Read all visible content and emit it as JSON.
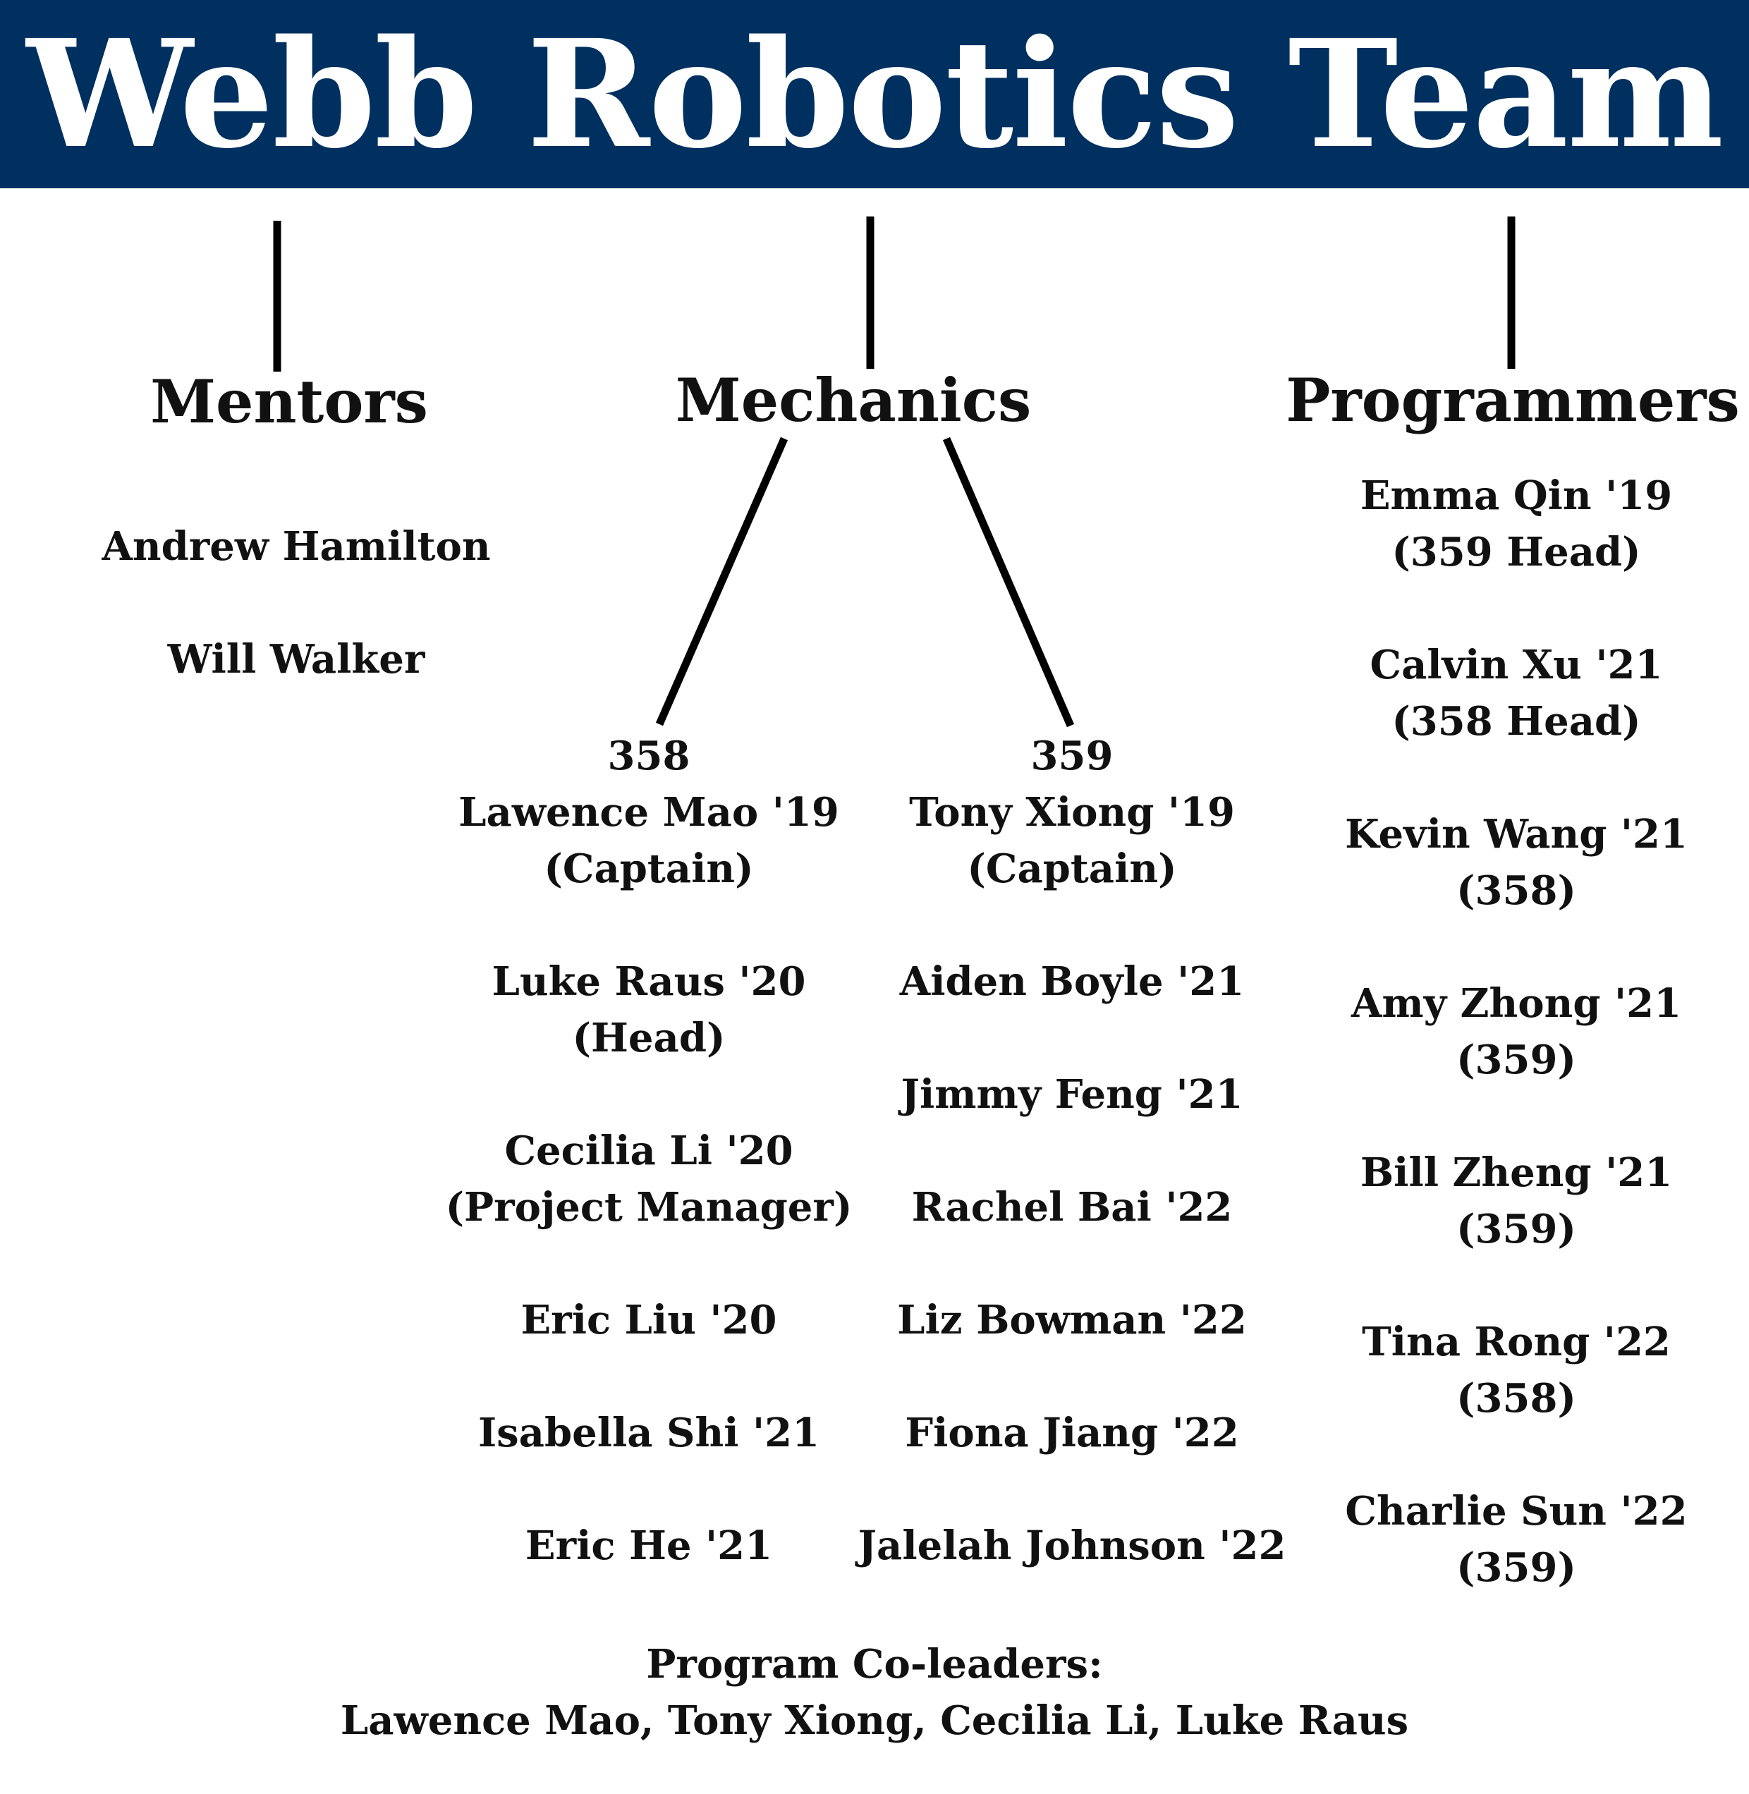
{
  "title": "Webb Robotics Team",
  "groups": {
    "mentors": {
      "label": "Mentors",
      "members": [
        "Andrew Hamilton",
        "Will Walker"
      ]
    },
    "mechanics": {
      "label": "Mechanics",
      "teams": [
        {
          "number": "358",
          "members": [
            {
              "name": "Lawence Mao '19",
              "role": "(Captain)"
            },
            {
              "name": "Luke Raus '20",
              "role": "(Head)"
            },
            {
              "name": "Cecilia Li '20",
              "role": "(Project Manager)"
            },
            {
              "name": "Eric Liu '20"
            },
            {
              "name": "Isabella Shi '21"
            },
            {
              "name": "Eric He '21"
            }
          ]
        },
        {
          "number": "359",
          "members": [
            {
              "name": "Tony Xiong '19",
              "role": "(Captain)"
            },
            {
              "name": "Aiden Boyle '21"
            },
            {
              "name": "Jimmy Feng '21"
            },
            {
              "name": "Rachel Bai '22"
            },
            {
              "name": "Liz Bowman '22"
            },
            {
              "name": "Fiona Jiang '22"
            },
            {
              "name": "Jalelah Johnson '22"
            }
          ]
        }
      ]
    },
    "programmers": {
      "label": "Programmers",
      "members": [
        {
          "name": "Emma Qin '19",
          "role": "(359 Head)"
        },
        {
          "name": "Calvin Xu '21",
          "role": "(358 Head)"
        },
        {
          "name": "Kevin Wang '21",
          "role": "(358)"
        },
        {
          "name": "Amy Zhong '21",
          "role": "(359)"
        },
        {
          "name": "Bill Zheng '21",
          "role": "(359)"
        },
        {
          "name": "Tina Rong '22",
          "role": "(358)"
        },
        {
          "name": "Charlie Sun '22",
          "role": "(359)"
        }
      ]
    }
  },
  "footer": {
    "heading": "Program Co-leaders:",
    "names": "Lawence Mao, Tony Xiong, Cecilia Li, Luke Raus"
  },
  "colors": {
    "banner": "#003060",
    "title_text": "#ffffff",
    "text": "#111111",
    "connector": "#000000"
  }
}
